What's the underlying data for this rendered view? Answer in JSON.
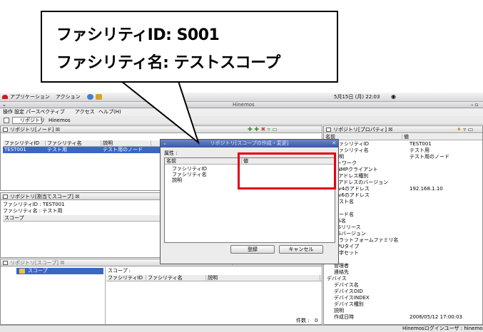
{
  "callout": {
    "line1": "ファシリティID:  S001",
    "line2": "ファシリティ名: テストスコープ"
  },
  "topbar": {
    "app_menu": "アプリケーション",
    "action_menu": "アクション",
    "clock": "5月15日 (月) 22:03"
  },
  "window": {
    "title": "Hinemos"
  },
  "menubar": {
    "items": [
      "操作",
      "設定",
      "パースペクティブ",
      "アクセス",
      "ヘルプ(H)"
    ]
  },
  "perspectives": {
    "tab1": "リポジトリ",
    "tab2": "Hinemos"
  },
  "node_panel": {
    "title": "リポジトリ[ノード]",
    "columns": [
      "ファシリティID",
      "ファシリティ名",
      "説明"
    ],
    "rows": [
      [
        "TEST001",
        "テスト用",
        "テスト用のノード"
      ]
    ]
  },
  "assign_panel": {
    "title": "リポジトリ[割当てスコープ]",
    "facility_id_line": "ファシリティID : TEST001",
    "facility_name_line": "ファシリティ名 : テスト用",
    "scope_header": "スコープ"
  },
  "scope_panel": {
    "title": "リポジトリ[スコープ]",
    "tree_item": "スコープ",
    "scope_label": "スコープ :",
    "columns": [
      "ファシリティID",
      "ファシリティ名",
      "説明"
    ],
    "count_label": "件数 :",
    "count_value": "0"
  },
  "dialog": {
    "title": "リポジトリ[スコープの作成・変更]",
    "attr_label": "属性 :",
    "col_name": "名前",
    "col_value": "値",
    "fields": [
      "ファシリティID",
      "ファシリティ名",
      "説明"
    ],
    "register_button": "登録",
    "cancel_button": "キャンセル"
  },
  "property_panel": {
    "title": "リポジトリ[プロパティ]",
    "col_name": "名前",
    "col_value": "値",
    "rows": [
      {
        "key": "ファシリティID",
        "value": "TEST001"
      },
      {
        "key": "ファシリティ名",
        "value": "テスト用"
      },
      {
        "key": "説明",
        "value": "テスト用のノード"
      },
      {
        "key": "ネットワーク",
        "value": ""
      },
      {
        "key": "SNMPクライアント",
        "value": ""
      },
      {
        "key": "IPアドレス種別",
        "value": ""
      },
      {
        "key": "IPアドレスのバージョン",
        "value": ""
      },
      {
        "key": "IPv4のアドレス",
        "value": "192.168.1.10"
      },
      {
        "key": "IPv6のアドレス",
        "value": ""
      },
      {
        "key": "ホスト名",
        "value": ""
      },
      {
        "key": "OS",
        "value": ""
      },
      {
        "key": "ノード名",
        "value": ""
      },
      {
        "key": "OS名",
        "value": ""
      },
      {
        "key": "OSリリース",
        "value": ""
      },
      {
        "key": "OSバージョン",
        "value": ""
      },
      {
        "key": "プラットフォームファミリ名",
        "value": ""
      },
      {
        "key": "CPUタイプ",
        "value": ""
      },
      {
        "key": "文字セット",
        "value": ""
      },
      {
        "key": "保守",
        "value": ""
      },
      {
        "key": "管理者",
        "value": ""
      },
      {
        "key": "連絡先",
        "value": ""
      },
      {
        "key": "デバイス",
        "value": ""
      },
      {
        "key": "デバイス名",
        "value": ""
      },
      {
        "key": "デバイスOID",
        "value": ""
      },
      {
        "key": "デバイスINDEX",
        "value": ""
      },
      {
        "key": "デバイス種別",
        "value": ""
      },
      {
        "key": "説明",
        "value": ""
      },
      {
        "key": "作成日時",
        "value": "2006/05/12 17:00:03"
      }
    ]
  },
  "status": {
    "login_user": "Hinemosログインユーザ : hinemos"
  },
  "colors": {
    "accent": "#3a66c4",
    "highlight_box": "#e60012"
  }
}
